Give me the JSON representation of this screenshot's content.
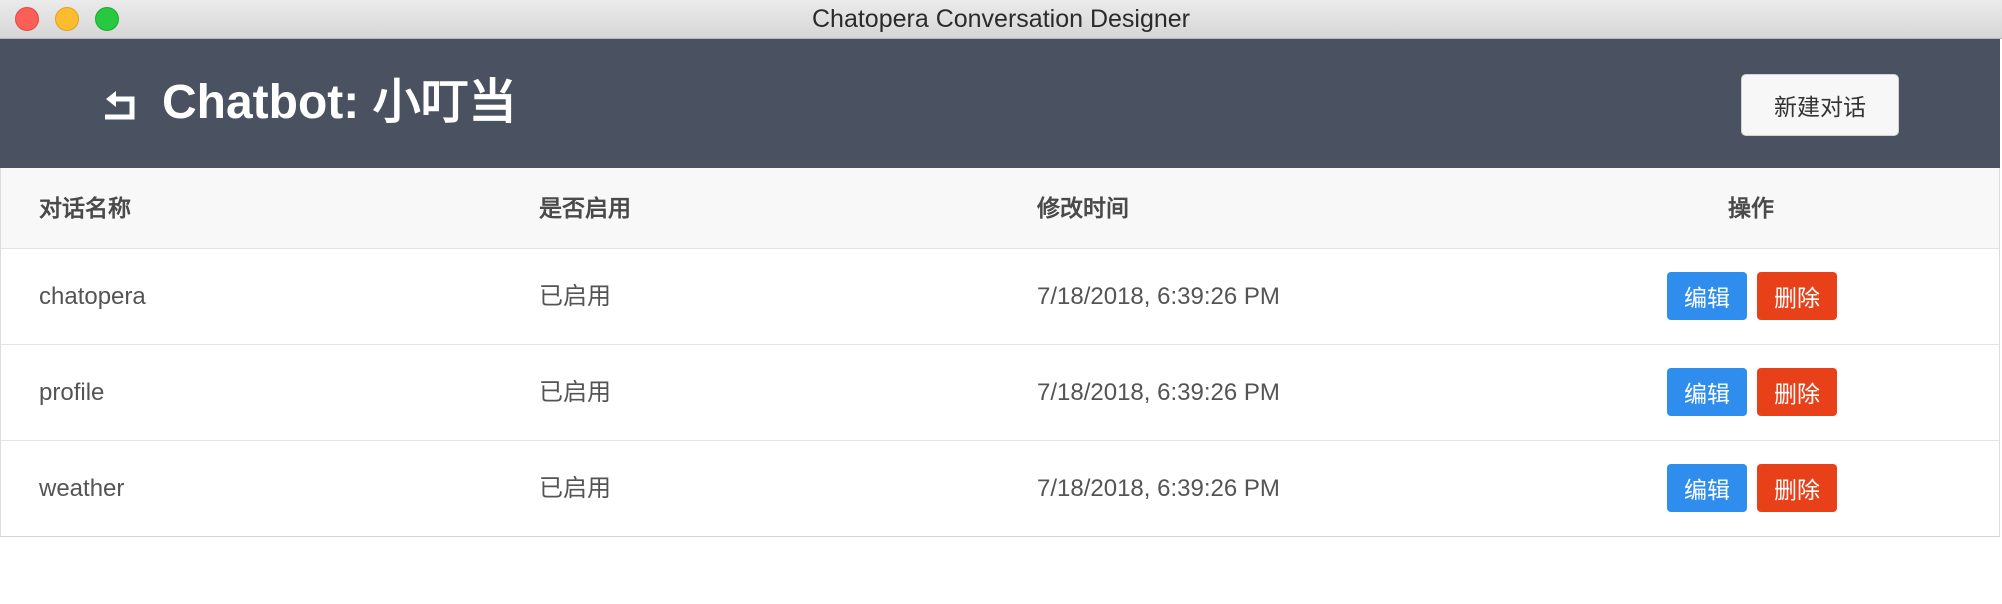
{
  "window": {
    "title": "Chatopera Conversation Designer"
  },
  "header": {
    "title": "Chatbot:  小叮当",
    "new_button_label": "新建对话"
  },
  "table": {
    "columns": [
      "对话名称",
      "是否启用",
      "修改时间",
      "操作"
    ],
    "rows": [
      {
        "name": "chatopera",
        "status": "已启用",
        "modified": "7/18/2018, 6:39:26 PM",
        "edit_label": "编辑",
        "delete_label": "删除"
      },
      {
        "name": "profile",
        "status": "已启用",
        "modified": "7/18/2018, 6:39:26 PM",
        "edit_label": "编辑",
        "delete_label": "删除"
      },
      {
        "name": "weather",
        "status": "已启用",
        "modified": "7/18/2018, 6:39:26 PM",
        "edit_label": "编辑",
        "delete_label": "删除"
      }
    ]
  },
  "colors": {
    "header_bg": "#4a5161",
    "edit": "#2f8ded",
    "delete": "#e8411a"
  },
  "icons": {
    "back": "return-arrow-icon"
  }
}
